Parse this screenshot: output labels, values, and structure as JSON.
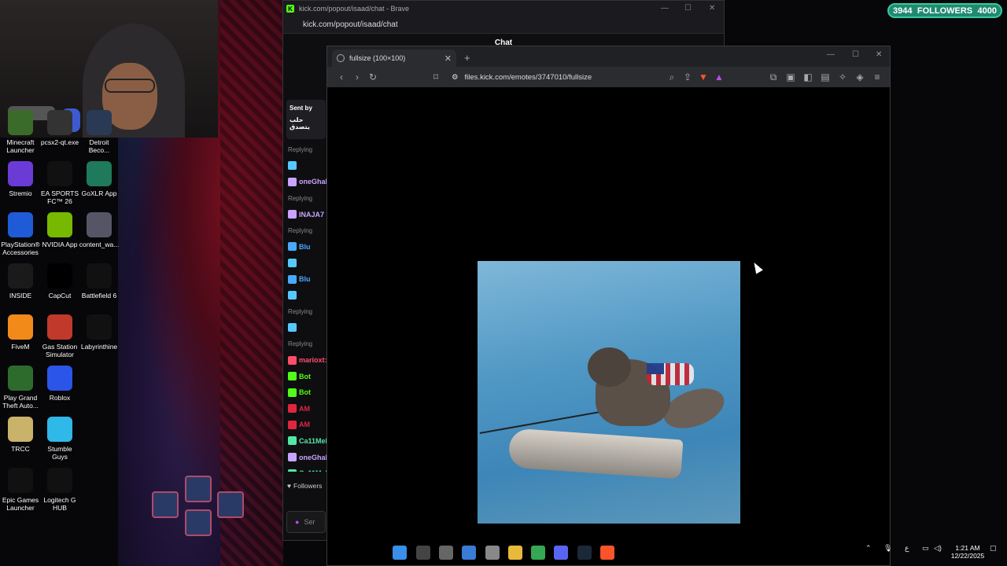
{
  "follower_goal": {
    "current": "3944",
    "label": "FOLLOWERS",
    "target": "4000"
  },
  "desktop_icons": [
    {
      "label": "Minecraft Launcher",
      "color": "#3a6b2a"
    },
    {
      "label": "pcsx2-qt.exe",
      "color": "#333"
    },
    {
      "label": "Detroit Beco...",
      "color": "#2a3a55"
    },
    {
      "label": "Stremio",
      "color": "#6b3bd6"
    },
    {
      "label": "EA SPORTS FC™ 26",
      "color": "#111"
    },
    {
      "label": "GoXLR App",
      "color": "#1e7a5a"
    },
    {
      "label": "PlayStation® Accessories",
      "color": "#1f5bd6"
    },
    {
      "label": "NVIDIA App",
      "color": "#76b900"
    },
    {
      "label": "content_wa...",
      "color": "#556"
    },
    {
      "label": "INSIDE",
      "color": "#1a1a1a"
    },
    {
      "label": "CapCut",
      "color": "#000"
    },
    {
      "label": "Battlefield 6",
      "color": "#111"
    },
    {
      "label": "FiveM",
      "color": "#f28a1a"
    },
    {
      "label": "Gas Station Simulator",
      "color": "#c0392b"
    },
    {
      "label": "Labyrinthine",
      "color": "#111"
    },
    {
      "label": "Play Grand Theft Auto...",
      "color": "#2d6b2d"
    },
    {
      "label": "Roblox",
      "color": "#2b54e8"
    },
    {
      "label": "TRCC",
      "color": "#c9b26a"
    },
    {
      "label": "Stumble Guys",
      "color": "#2fb8e8"
    },
    {
      "label": "Epic Games Launcher",
      "color": "#111"
    },
    {
      "label": "Logitech G HUB",
      "color": "#111"
    }
  ],
  "chat_window": {
    "title": "kick.com/popout/isaad/chat - Brave",
    "url": "kick.com/popout/isaad/chat",
    "header": "Chat",
    "sent_by": "Sent by",
    "sent_text": "حلب يتصدق",
    "input_placeholder": "Ser",
    "followers_label": "Followers",
    "lines": [
      {
        "kind": "reply",
        "text": "Replying"
      },
      {
        "kind": "msg",
        "text": "",
        "color": "#56c8ff"
      },
      {
        "kind": "name",
        "text": "oneGhala:",
        "color": "#c9a3ff"
      },
      {
        "kind": "reply",
        "text": "Replying"
      },
      {
        "kind": "name",
        "text": "INAJA7",
        "color": "#c9a3ff"
      },
      {
        "kind": "reply",
        "text": "Replying"
      },
      {
        "kind": "name",
        "text": "Blu",
        "color": "#4aa8ff"
      },
      {
        "kind": "msg",
        "text": "",
        "color": "#56c8ff"
      },
      {
        "kind": "name",
        "text": "Blu",
        "color": "#4aa8ff"
      },
      {
        "kind": "msg",
        "text": "",
        "color": "#56c8ff"
      },
      {
        "kind": "reply",
        "text": "Replying"
      },
      {
        "kind": "msg",
        "text": "",
        "color": "#56c8ff"
      },
      {
        "kind": "reply",
        "text": "Replying"
      },
      {
        "kind": "name",
        "text": "marioxt:",
        "color": "#ff4d6a"
      },
      {
        "kind": "name",
        "text": "Bot",
        "color": "#53fc18"
      },
      {
        "kind": "name",
        "text": "Bot",
        "color": "#53fc18"
      },
      {
        "kind": "name",
        "text": "AM",
        "color": "#e0263f"
      },
      {
        "kind": "name",
        "text": "AM",
        "color": "#e0263f"
      },
      {
        "kind": "name",
        "text": "Ca11MeDo",
        "color": "#53e6a6"
      },
      {
        "kind": "name",
        "text": "oneGhala:",
        "color": "#c9a3ff"
      },
      {
        "kind": "name",
        "text": "Ca11MeDo",
        "color": "#53e6a6"
      },
      {
        "kind": "msg",
        "text": "",
        "color": "#56c8ff"
      },
      {
        "kind": "msg",
        "text": "",
        "color": "#56c8ff"
      }
    ]
  },
  "viewer_window": {
    "tab_title": "fullsize (100×100)",
    "url": "files.kick.com/emotes/3747010/fullsize"
  },
  "taskbar": {
    "time": "1:21 AM",
    "date": "12/22/2025",
    "lang": "ع",
    "apps": [
      {
        "name": "start",
        "color": "#3a8fe8"
      },
      {
        "name": "search",
        "color": "#444"
      },
      {
        "name": "task-view",
        "color": "#666"
      },
      {
        "name": "store",
        "color": "#3a7bd5"
      },
      {
        "name": "recording",
        "color": "#888"
      },
      {
        "name": "file-explorer",
        "color": "#e8b93a"
      },
      {
        "name": "chrome",
        "color": "#34a853"
      },
      {
        "name": "discord",
        "color": "#5865f2"
      },
      {
        "name": "steam",
        "color": "#1b2838"
      },
      {
        "name": "brave",
        "color": "#fb542b"
      }
    ]
  },
  "colors": {
    "kick_green": "#53fc18",
    "follower_bg": "#1f8a70"
  }
}
